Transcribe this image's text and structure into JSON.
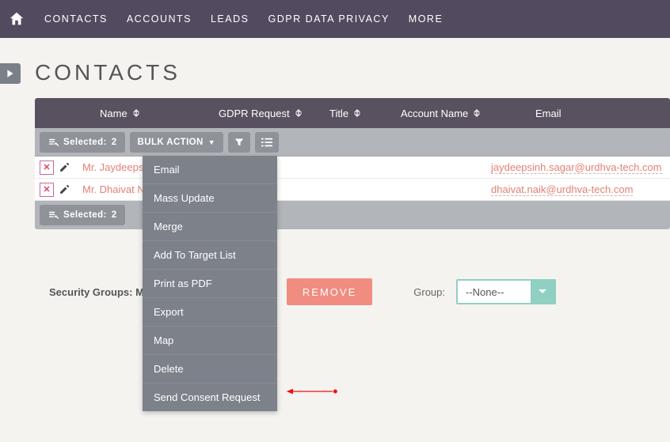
{
  "nav": {
    "items": [
      "CONTACTS",
      "ACCOUNTS",
      "LEADS",
      "GDPR DATA PRIVACY",
      "MORE"
    ]
  },
  "page_title": "CONTACTS",
  "columns": {
    "name": "Name",
    "gdpr": "GDPR Request",
    "title": "Title",
    "account": "Account Name",
    "email": "Email"
  },
  "toolbar": {
    "selected_label": "Selected:",
    "selected_count": "2",
    "bulk_action": "BULK ACTION"
  },
  "rows": [
    {
      "name": "Mr. Jaydeepsin",
      "email": "jaydeepsinh.sagar@urdhva-tech.com"
    },
    {
      "name": "Mr. Dhaivat Na",
      "email": "dhaivat.naik@urdhva-tech.com"
    }
  ],
  "bulk_menu": [
    "Email",
    "Mass Update",
    "Merge",
    "Add To Target List",
    "Print as PDF",
    "Export",
    "Map",
    "Delete",
    "Send Consent Request"
  ],
  "security": {
    "label": "Security Groups: M",
    "remove": "REMOVE",
    "group_label": "Group:",
    "group_value": "--None--"
  }
}
